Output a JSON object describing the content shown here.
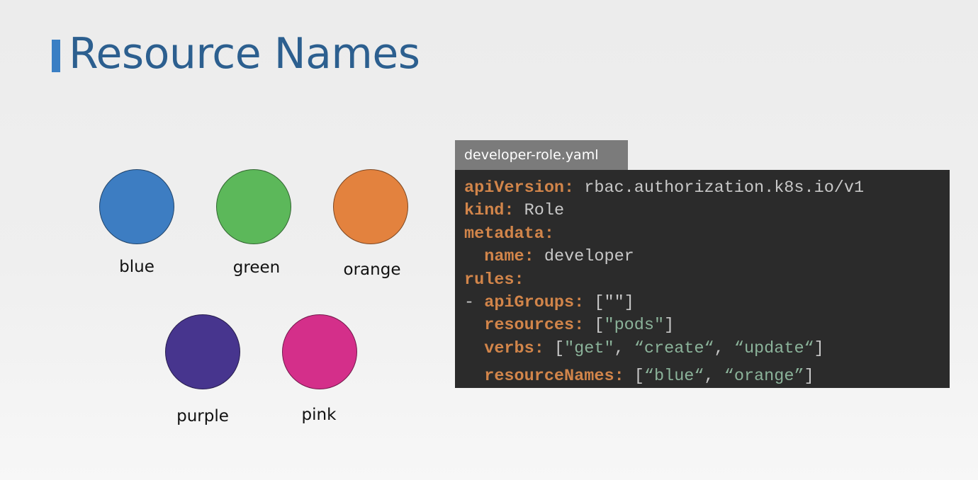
{
  "slide": {
    "title": "Resource Names"
  },
  "swatches": [
    {
      "label": "blue",
      "color": "#3d7dc2"
    },
    {
      "label": "green",
      "color": "#5cb85a"
    },
    {
      "label": "orange",
      "color": "#e3823e"
    },
    {
      "label": "purple",
      "color": "#47358e"
    },
    {
      "label": "pink",
      "color": "#d42f8a"
    }
  ],
  "code": {
    "filename": "developer-role.yaml",
    "lines": {
      "api_version_key": "apiVersion",
      "api_version_value": "rbac.authorization.k8s.io/v1",
      "kind_key": "kind",
      "kind_value": "Role",
      "metadata_key": "metadata",
      "name_key": "name",
      "name_value": "developer",
      "rules_key": "rules",
      "api_groups_key": "apiGroups",
      "api_groups_value": "\"\"",
      "resources_key": "resources",
      "resources_value": "\"pods\"",
      "verbs_key": "verbs",
      "verbs_value_1": "\"get\"",
      "verbs_value_2": "“create“",
      "verbs_value_3": "“update“",
      "resource_names_key": "resourceNames",
      "resource_names_value_1": "“blue“",
      "resource_names_value_2": "“orange”"
    }
  },
  "colors": {
    "title": "#2c5f8f",
    "title_accent": "#3a7fc4",
    "code_background": "#2b2b2b",
    "code_key": "#d2854a",
    "code_value": "#c8c8c8",
    "code_string": "#8bb39a",
    "file_tab": "#7b7b7b"
  }
}
